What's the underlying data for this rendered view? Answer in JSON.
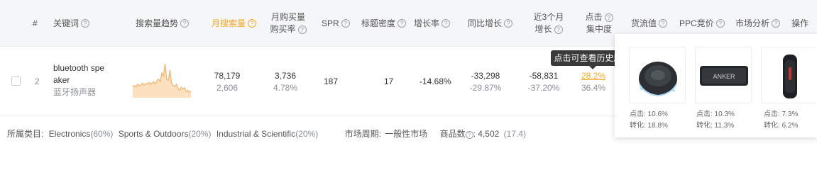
{
  "header": {
    "col_index": "#",
    "col_keyword": "关键词",
    "col_trend": "搜索量趋势",
    "col_monthly_search": "月搜索量",
    "col_monthly_purchase_l1": "月购买量",
    "col_monthly_purchase_l2": "购买率",
    "col_spr": "SPR",
    "col_title_density": "标题密度",
    "col_growth_rate": "增长率",
    "col_yoy": "同比增长",
    "col_recent3_l1": "近3个月",
    "col_recent3_l2": "增长",
    "col_click_l1": "点击",
    "col_click_l2": "集中度",
    "col_cargo_value": "货流值",
    "col_ppc": "PPC竞价",
    "col_market": "市场分析",
    "col_actions": "操作"
  },
  "row": {
    "index": "2",
    "keyword_line1": "bluetooth spe",
    "keyword_line2": "aker",
    "keyword_cn": "蓝牙扬声器",
    "monthly_search": "78,179",
    "monthly_search_sub": "2,606",
    "monthly_purchase": "3,736",
    "purchase_rate": "4.78%",
    "spr": "187",
    "title_density": "17",
    "growth_rate": "-14.68%",
    "yoy": "-33,298",
    "yoy_pct": "-29.87%",
    "recent3": "-58,831",
    "recent3_pct": "-37.20%",
    "click_conc": "28.2%",
    "click_conc_sub": "36.4%"
  },
  "sparkline": [
    18,
    20,
    17,
    22,
    19,
    21,
    24,
    20,
    23,
    22,
    25,
    21,
    24,
    26,
    22,
    28,
    30,
    26,
    40,
    35,
    55,
    30,
    28,
    45,
    24,
    20,
    18,
    22,
    15,
    12,
    17,
    14,
    16,
    10,
    12,
    9,
    11
  ],
  "tooltip": "点击可查看历史趋势",
  "products": [
    {
      "click": "点击: 10.6%",
      "conv": "转化: 18.8%"
    },
    {
      "click": "点击: 10.3%",
      "conv": "转化: 11.3%",
      "brand": "ANKER"
    },
    {
      "click": "点击: 7.3%",
      "conv": "转化: 6.2%"
    }
  ],
  "footer": {
    "category_label": "所属类目:",
    "cat1": "Electronics",
    "cat1_pct": "(60%)",
    "cat2": "Sports & Outdoors",
    "cat2_pct": "(20%)",
    "cat3": "Industrial & Scientific",
    "cat3_pct": "(20%)",
    "cycle_label": "市场周期:",
    "cycle_value": "一般性市场",
    "count_label": "商品数",
    "count_value": ": 4,502",
    "count_sub": "(17.4)"
  },
  "colors": {
    "accent": "#f5a623",
    "sparkline_fill": "#fbe1bf",
    "sparkline_line": "#f3b36a",
    "tooltip_bg": "#3a3a3a"
  }
}
